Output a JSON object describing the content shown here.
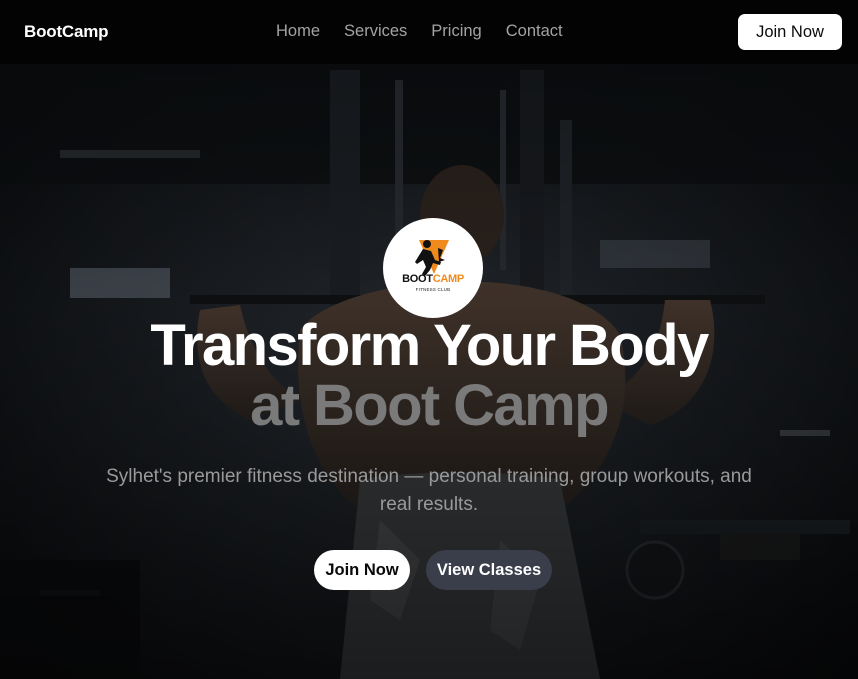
{
  "nav": {
    "brand": "BootCamp",
    "links": [
      "Home",
      "Services",
      "Pricing",
      "Contact"
    ],
    "cta": "Join Now"
  },
  "hero": {
    "logo": {
      "name_part1": "BOOT",
      "name_part2": "CAMP",
      "tagline": "FITNESS CLUB"
    },
    "headline_line1": "Transform Your Body",
    "headline_line2": "at Boot Camp",
    "subtitle": "Sylhet's premier fitness destination — personal training, group workouts, and real results.",
    "primary_button": "Join Now",
    "secondary_button": "View Classes"
  },
  "colors": {
    "accent": "#f08a1c",
    "secondary_button": "#3a3d4a",
    "headline_muted": "#7a7a7a"
  },
  "icons": {
    "logo_emblem": "running-athlete-icon"
  }
}
